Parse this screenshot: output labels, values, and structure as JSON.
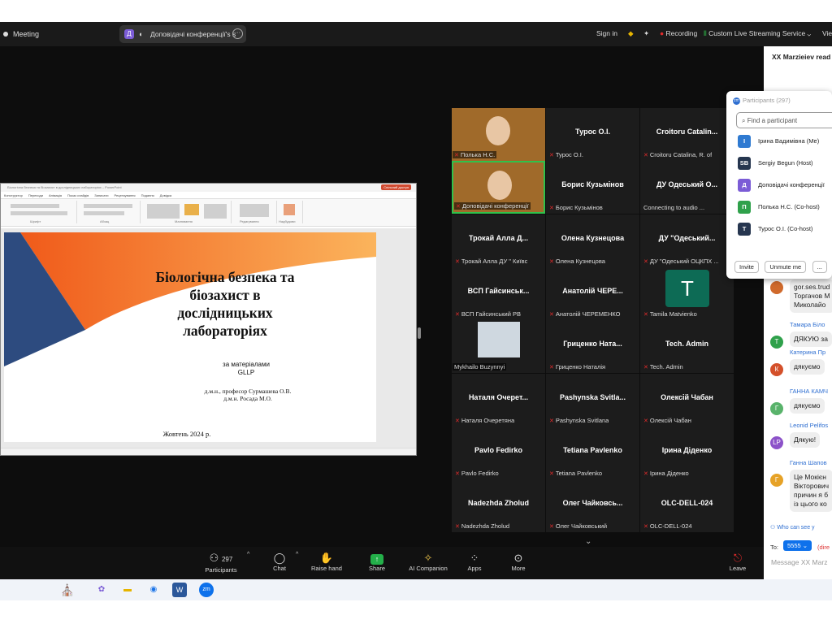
{
  "window": {
    "app_name": "Meeting",
    "meeting_avatar": "Д",
    "meeting_title": "Доповідачі конференції's s",
    "more_label": "···",
    "sign_in": "Sign in",
    "recording": "Recording",
    "live_stream": "Custom Live Streaming Service",
    "view": "Vie"
  },
  "slide": {
    "title_line1": "Біологічна безпека та",
    "title_line2": "біозахист в",
    "title_line3": "дослідницьких",
    "title_line4": "лабораторіях",
    "sub1": "за матеріалами",
    "sub2": "GLLP",
    "author1": "д.м.н., професор Сурмашева О.В.",
    "author2": "д.м.н. Росада М.О.",
    "date": "Жовтень 2024 р."
  },
  "ppt": {
    "titlebar_text": "Біологічна безпека та біозахист в дослідницьких лабораторіях – PowerPoint",
    "share_button": "Спільний доступ",
    "tabs": [
      "Конструктор",
      "Переходи",
      "Анімація",
      "Показ слайдів",
      "Записати",
      "Рецензування",
      "Подання",
      "Довідка"
    ],
    "groups": [
      "Шрифт",
      "Абзац",
      "Малювання",
      "Редагування",
      "Надбудови"
    ]
  },
  "gallery": [
    {
      "name": "",
      "label": "Полька Н.С.",
      "video": true
    },
    {
      "name": "Турос О.І.",
      "label": "Турос О.І."
    },
    {
      "name": "Croitoru Catalin...",
      "label": "Croitoru Catalina, R. of"
    },
    {
      "name": "",
      "label": "Доповідачі конференції",
      "video": true,
      "active": true
    },
    {
      "name": "Борис Кузьмінов",
      "label": "Борис Кузьмінов"
    },
    {
      "name": "ДУ Одеський О...",
      "label": "Connecting to audio ...",
      "nomic": true
    },
    {
      "name": "Трокай Алла Д...",
      "label": "Трокай Алла ДУ \" Київс"
    },
    {
      "name": "Олена Кузнецова",
      "label": "Олена Кузнецова"
    },
    {
      "name": "ДУ \"Одеський...",
      "label": "ДУ \"Одеський ОЦКПХ ..."
    },
    {
      "name": "ВСП Гайсинськ...",
      "label": "ВСП Гайсинський РВ"
    },
    {
      "name": "Анатолій ЧЕРЕ...",
      "label": "Анатолій ЧЕРЕМЕНКО"
    },
    {
      "name": "",
      "label": "Tamila Matvienko",
      "avatar": "T"
    },
    {
      "name": "",
      "label": "Mykhailo Buzynnyi",
      "photo": true,
      "nomic": true
    },
    {
      "name": "Гриценко Ната...",
      "label": "Гриценко Наталія"
    },
    {
      "name": "Tech. Admin",
      "label": "Tech. Admin"
    },
    {
      "name": "Наталя Очерет...",
      "label": "Наталя Очеретяна"
    },
    {
      "name": "Pashynska Svitla...",
      "label": "Pashynska Svitlana"
    },
    {
      "name": "Олексій Чабан",
      "label": "Олексій Чабан"
    },
    {
      "name": "Pavlo Fedirko",
      "label": "Pavlo Fedirko"
    },
    {
      "name": "Tetiana Pavlenko",
      "label": "Tetiana Pavlenko"
    },
    {
      "name": "Ірина Діденко",
      "label": "Ірина Діденко"
    },
    {
      "name": "Nadezhda Zholud",
      "label": "Nadezhda Zholud"
    },
    {
      "name": "Олег Чайковсь...",
      "label": "Олег Чайковський"
    },
    {
      "name": "OLC-DELL-024",
      "label": "OLC-DELL-024"
    }
  ],
  "toolbar": {
    "participants_count": "297",
    "participants": "Participants",
    "chat": "Chat",
    "raise_hand": "Raise hand",
    "share": "Share",
    "ai": "AI Companion",
    "apps": "Apps",
    "more": "More",
    "leave": "Leave"
  },
  "chat": {
    "header": "XX Marzieiev read",
    "messages": [
      {
        "author": "",
        "text": "gor.ses.trud",
        "extra": [
          "Торгачов М",
          "Миколайо"
        ],
        "avatar": "",
        "color": "#d06a2c"
      },
      {
        "author": "Тамара Біло",
        "text": "ДЯКУЮ за",
        "avatar": "T",
        "color": "#2fa14b"
      },
      {
        "author": "Катерина Пр",
        "text": "дякуємо",
        "avatar": "К",
        "color": "#d4502a"
      },
      {
        "author": "ГАННА КАМЧ",
        "text": "дякуємо",
        "avatar": "Г",
        "color": "#59b36b"
      },
      {
        "author": "Leonid Pelifos",
        "text": "Дякую!",
        "avatar": "LP",
        "color": "#8c52c9"
      },
      {
        "author": "Ганна Шапов",
        "text": "Це Мокієн",
        "extra": [
          "Вікторович",
          "причин я б",
          "із цього ко"
        ],
        "avatar": "Г",
        "color": "#e6a227"
      }
    ],
    "who_can_see": "Who can see y",
    "to_label": "To:",
    "to_value": "5555",
    "to_rest": "(dire",
    "placeholder": "Message XX Marz"
  },
  "participants_panel": {
    "title": "Participants (297)",
    "search_placeholder": "Find a participant",
    "rows": [
      {
        "avatar": "І",
        "name": "Ірина Вадимівна (Me)",
        "color": "#2f7ad1"
      },
      {
        "avatar": "SB",
        "name": "Sergiy Begun (Host)",
        "color": "#26364f"
      },
      {
        "avatar": "Д",
        "name": "Доповідачі конференції",
        "color": "#7b5cd6"
      },
      {
        "avatar": "П",
        "name": "Полька Н.С. (Co-host)",
        "color": "#2fa14b"
      },
      {
        "avatar": "Т",
        "name": "Турос О.І. (Co-host)",
        "color": "#26364f"
      }
    ],
    "invite": "Invite",
    "unmute": "Unmute me",
    "more": "..."
  },
  "colors": {
    "accent": "#0e71eb",
    "active_speaker": "#2fc14b",
    "recording": "#e02b2b"
  }
}
